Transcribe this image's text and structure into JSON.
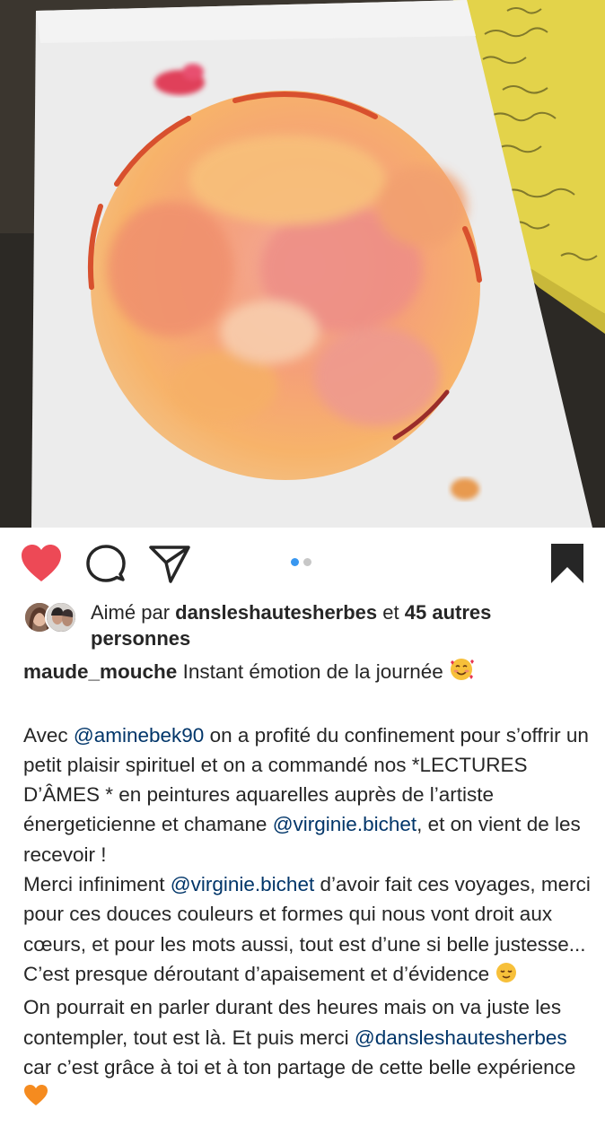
{
  "post": {
    "image_alt": "watercolor painting of orange sphere",
    "carousel": {
      "count": 2,
      "active_index": 0
    },
    "liked": true,
    "saved": true
  },
  "actions": {
    "like_icon": "heart-icon",
    "comment_icon": "comment-icon",
    "share_icon": "paper-plane-icon",
    "save_icon": "bookmark-icon"
  },
  "likes": {
    "prefix": "Aimé par",
    "user": "dansleshautesherbes",
    "connector": "et",
    "others": "45 autres personnes"
  },
  "caption": {
    "username": "maude_mouche",
    "title": "Instant émotion de la journée",
    "p1_a": "Avec ",
    "mention1": "@aminebek90",
    "p1_b": " on a profité du confinement pour s’offrir un petit plaisir spirituel et on a commandé nos *LECTURES D’ÂMES * en peintures aquarelles auprès de l’artiste énergeticienne et chamane ",
    "mention2": "@virginie.bichet",
    "p1_c": ", et on vient de les recevoir !",
    "p2_a": "Merci infiniment ",
    "mention3": "@virginie.bichet",
    "p2_b": " d’avoir fait ces voyages, merci pour ces douces couleurs et formes qui nous vont droit aux cœurs, et pour les mots aussi, tout est d’une si belle justesse... C’est presque déroutant d’apaisement et d’évidence",
    "p3_a": "On pourrait en parler durant des heures mais on va juste les contempler, tout est là. Et puis merci ",
    "mention4": "@dansleshautesherbes",
    "p3_b": " car c’est grâce à toi et à ton partage de cette belle expérience"
  },
  "colors": {
    "heart": "#ed4956",
    "mention": "#003569",
    "dot_active": "#3897f0",
    "dot_inactive": "#c7c7c7",
    "text": "#262626"
  }
}
